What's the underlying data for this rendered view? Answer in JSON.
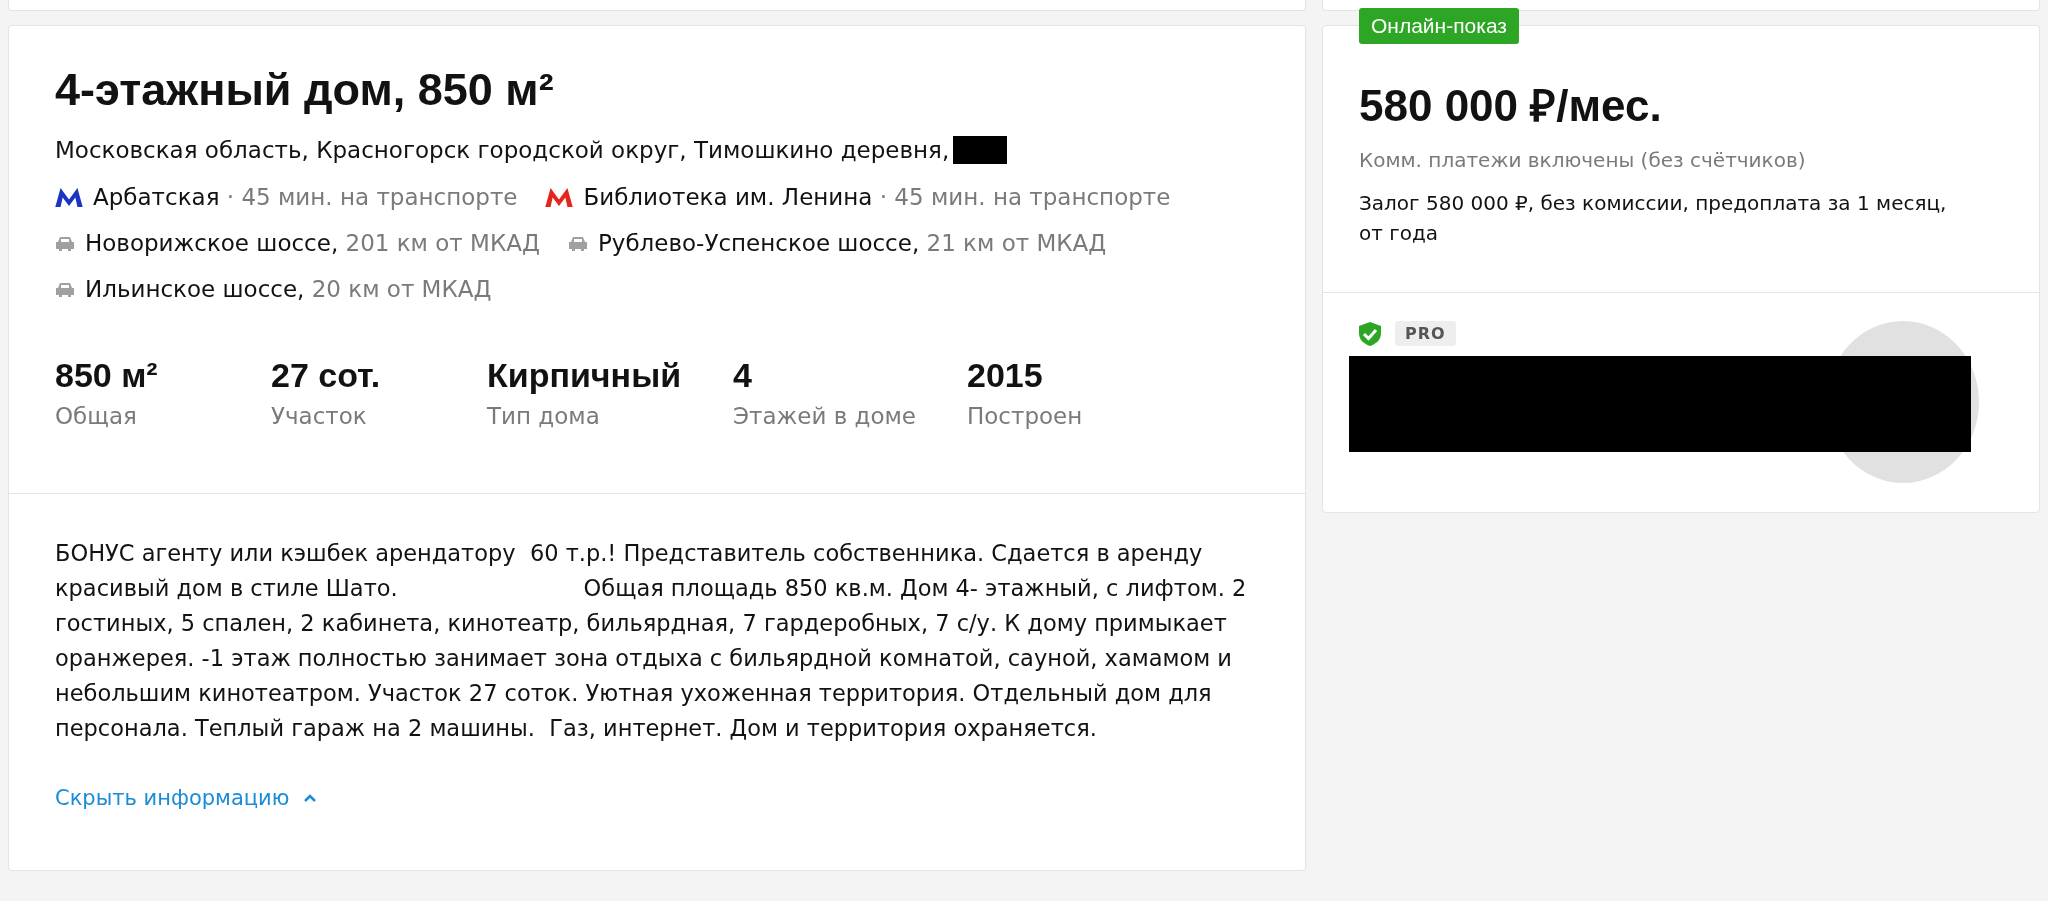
{
  "listing": {
    "title": "4-этажный дом, 850 м²",
    "address": "Московская область, Красногорск городской округ, Тимошкино деревня,",
    "address_redacted": true,
    "metro": [
      {
        "station": "Арбатская",
        "travel": "· 45 мин. на транспорте",
        "color": "#1b35c2"
      },
      {
        "station": "Библиотека им. Ленина",
        "travel": "· 45 мин. на транспорте",
        "color": "#e5251d"
      }
    ],
    "highways": [
      {
        "name": "Новорижское шоссе,",
        "distance": "201 км от МКАД"
      },
      {
        "name": "Рублево-Успенское шоссе,",
        "distance": "21 км от МКАД"
      },
      {
        "name": "Ильинское шоссе,",
        "distance": "20 км от МКАД"
      }
    ],
    "stats": [
      {
        "value": "850 м²",
        "label": "Общая"
      },
      {
        "value": "27 сот.",
        "label": "Участок"
      },
      {
        "value": "Кирпичный",
        "label": "Тип дома"
      },
      {
        "value": "4",
        "label": "Этажей в доме"
      },
      {
        "value": "2015",
        "label": "Построен"
      }
    ],
    "description": "БОНУС агенту или кэшбек арендатору  60 т.р.! Представитель собственника. Сдается в аренду красивый дом в стиле Шато.                          Общая площадь 850 кв.м. Дом 4- этажный, с лифтом. 2 гостиных, 5 спален, 2 кабинета, кинотеатр, бильярдная, 7 гардеробных, 7 с/у. К дому примыкает оранжерея. -1 этаж полностью занимает зона отдыха с бильярдной комнатой, сауной, хамамом и небольшим кинотеатром. Участок 27 соток. Уютная ухоженная территория. Отдельный дом для персонала. Теплый гараж на 2 машины.  Газ, интернет. Дом и территория охраняется.",
    "toggle": {
      "label": "Скрыть информацию",
      "expanded": true
    }
  },
  "price_card": {
    "badge": "Онлайн-показ",
    "price": "580 000 ₽/мес.",
    "utilities": "Комм. платежи включены (без счётчиков)",
    "terms": "Залог 580 000 ₽, без комиссии, предоплата за 1 месяц, от года"
  },
  "agent_card": {
    "verified": true,
    "tag": "PRO",
    "name_redacted": true
  }
}
